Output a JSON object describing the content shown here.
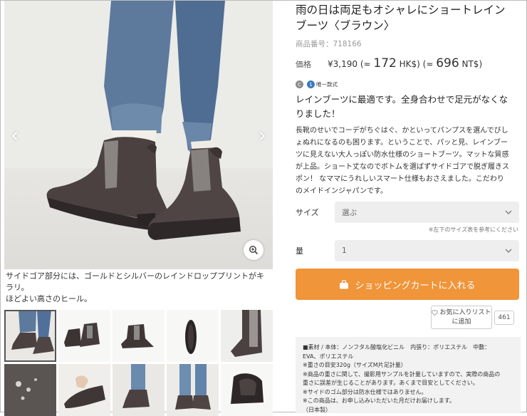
{
  "gallery": {
    "prev_icon": "chevron-left-icon",
    "next_icon": "chevron-right-icon",
    "zoom_icon": "zoom-in-icon",
    "caption_line1": "サイドゴア部分には、ゴールドとシルバーのレインドロッププリントがキラリ。",
    "caption_line2": "ほどよい高さのヒール。",
    "thumbnail_count": 10
  },
  "product": {
    "title_line1": "雨の日は両足もオシャレにショートレイン",
    "title_line2": "ブーツ〈ブラウン〉",
    "sku_label": "商品番号：",
    "sku": "718166",
    "price_label": "価格",
    "price_yen": "¥3,190",
    "approx_open1": " (≈ ",
    "price_hkd": "172",
    "hkd_unit": " HK$) ",
    "approx_open2": "(≈ ",
    "price_ntd": "696",
    "ntd_unit": " NT$)",
    "badge_c": "C",
    "badge_unique": "唯一款式",
    "lead_line1": "レインブーツに最適です。全身合わせで足元がなくな",
    "lead_line2": "りました！",
    "desc_lines": [
      "長靴のせいでコーデがちぐはぐ、かといってパンプスを選んでびし",
      "ょぬれになるのも困ります。ということで、パッと見、レインブー",
      "ツに見えない大人っぽい防水仕様のショートブーツ。マットな質感",
      "が上品。ショート丈なのでボトムを選ばずサイドゴアで脱ぎ履きス",
      "ポン！ なママにうれしいスマート仕様もおさえました。こだわり",
      "のメイドインジャパンです。"
    ]
  },
  "options": {
    "size_label": "サイズ",
    "size_value": "選ぶ",
    "size_note": "※左下のサイズ表を参考にください",
    "qty_label": "量",
    "qty_value": "1"
  },
  "actions": {
    "cart_label": "ショッピングカートに入れる",
    "fav_line1": "お気に入りリスト",
    "fav_line2": "に追加",
    "fav_count": "461"
  },
  "spec": {
    "lines": [
      "■素材 / 本体：ノンフタル酸塩化ビニル　内張り：ポリエステル　中敷：",
      "EVA、ポリエステル",
      "※重さの目安320g（サイズM片足計量）",
      "※商品の重さに関して、撮影用サンプルを計量していますので、実際の商品の",
      "重さに誤差が生じることがあります。あくまで目安としてください。",
      "※サイドのゴム部分は防水仕様ではありません。",
      "※この商品は、お申し込みいただいた月だけお届けします。",
      "（日本製）"
    ]
  },
  "colors": {
    "accent": "#f0953a",
    "boot": "#4a4140",
    "denim": "#5a7596",
    "badge_blue": "#3a7bbf"
  }
}
